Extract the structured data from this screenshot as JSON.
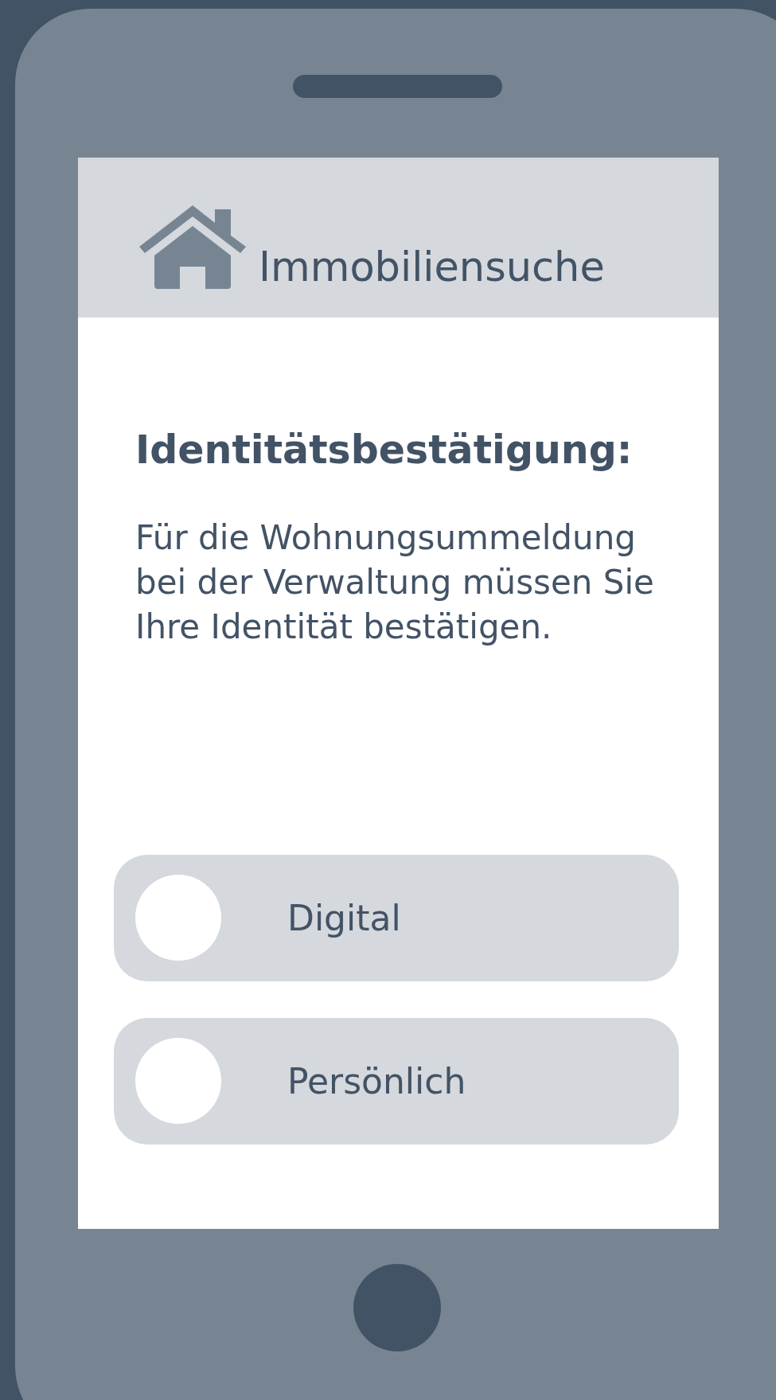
{
  "app_bar": {
    "title": "Immobiliensuche"
  },
  "heading": "Identitätsbestätigung:",
  "message": "Für die Wohnungsummeldung bei der Verwaltung müssen Sie Ihre Identität bestätigen.",
  "options": [
    {
      "label": "Digital",
      "selected": false
    },
    {
      "label": "Persönlich",
      "selected": false
    }
  ]
}
